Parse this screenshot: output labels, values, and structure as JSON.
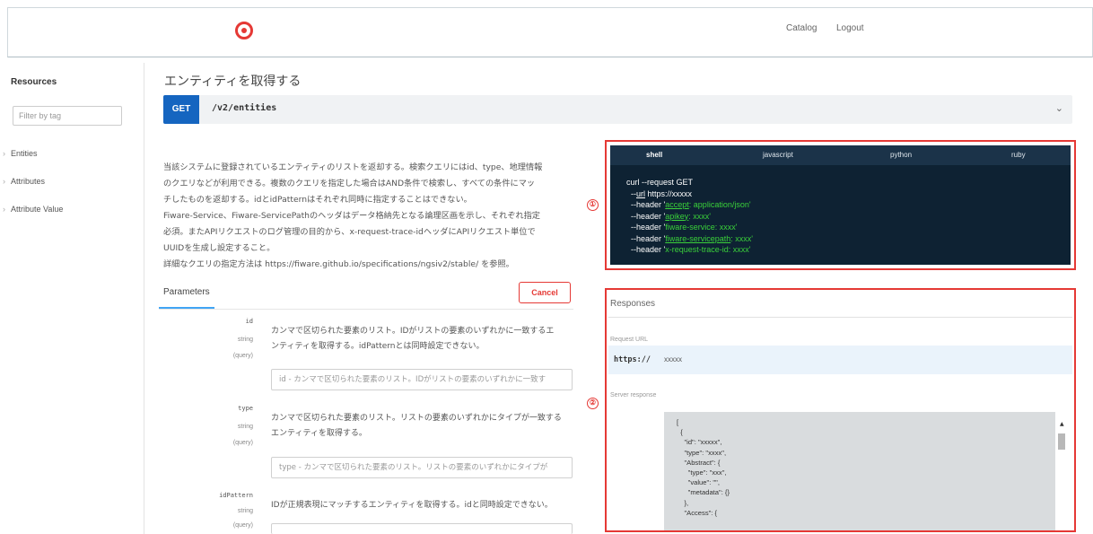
{
  "header": {
    "logo": "target-logo",
    "nav": {
      "catalog": "Catalog",
      "logout": "Logout"
    }
  },
  "sidebar": {
    "title": "Resources",
    "filter_placeholder": "Filter by tag",
    "items": [
      {
        "label": "Entities"
      },
      {
        "label": "Attributes"
      },
      {
        "label": "Attribute Value"
      }
    ]
  },
  "operation": {
    "title": "エンティティを取得する",
    "method": "GET",
    "path": "/v2/entities",
    "description": [
      "当該システムに登録されているエンティティのリストを返却する。検索クエリにはid、type、地理情報",
      "のクエリなどが利用できる。複数のクエリを指定した場合はAND条件で検索し、すべての条件にマッ",
      "チしたものを返却する。idとidPatternはそれぞれ同時に指定することはできない。",
      "Fiware-Service、Fiware-ServicePathのヘッダはデータ格納先となる論理区画を示し、それぞれ指定",
      "必須。またAPIリクエストのログ管理の目的から、x-request-trace-idヘッダにAPIリクエスト単位で",
      "UUIDを生成し設定すること。",
      "詳細なクエリの指定方法は https://fiware.github.io/specifications/ngsiv2/stable/ を参照。"
    ]
  },
  "parameters": {
    "tab_label": "Parameters",
    "cancel_label": "Cancel",
    "items": [
      {
        "name": "id",
        "type": "string",
        "in": "(query)",
        "description": [
          "カンマで区切られた要素のリスト。IDがリストの要素のいずれかに一致するエ",
          "ンティティを取得する。idPatternとは同時設定できない。"
        ],
        "placeholder": "id - カンマで区切られた要素のリスト。IDがリストの要素のいずれかに一致す"
      },
      {
        "name": "type",
        "type": "string",
        "in": "(query)",
        "description": [
          "カンマで区切られた要素のリスト。リストの要素のいずれかにタイプが一致する",
          "エンティティを取得する。"
        ],
        "placeholder": "type - カンマで区切られた要素のリスト。リストの要素のいずれかにタイプが"
      },
      {
        "name": "idPattern",
        "type": "string",
        "in": "(query)",
        "description": [
          "IDが正規表現にマッチするエンティティを取得する。idと同時設定できない。"
        ],
        "placeholder": ""
      }
    ]
  },
  "code_sample": {
    "tabs": [
      "shell",
      "javascript",
      "python",
      "ruby"
    ],
    "active_tab": "shell",
    "lines": {
      "l1": "curl --request GET",
      "l2a": "--",
      "l2b": "url",
      "l2c": " https://xxxxx",
      "l3a": "--header '",
      "l3b": "accept",
      "l3c": ": application/json'",
      "l4a": "--header '",
      "l4b": "apikey",
      "l4c": ": xxxx'",
      "l5a": "--header '",
      "l5b": "fiware-service: xxxx'",
      "l6a": "--header '",
      "l6b": "fiware-servicepath",
      "l6c": ": xxxx'",
      "l7a": "--header '",
      "l7b": "x-request-trace-id: xxxx'"
    }
  },
  "annotations": {
    "m1": "①",
    "m2": "②"
  },
  "responses": {
    "title": "Responses",
    "request_url_label": "Request URL",
    "request_url_proto": "https://",
    "request_url_host": "xxxxx",
    "server_response_label": "Server response",
    "json_body": "[\n  {\n    \"id\": \"xxxxx\",\n    \"type\": \"xxxx\",\n    \"Abstract\": {\n      \"type\": \"xxx\",\n      \"value\": \"\",\n      \"metadata\": {}\n    },\n    \"Access\": {"
  },
  "colors": {
    "accent": "#1565c0",
    "annotation_red": "#e53935",
    "code_bg": "#0e2233",
    "code_green": "#3ad13a"
  }
}
